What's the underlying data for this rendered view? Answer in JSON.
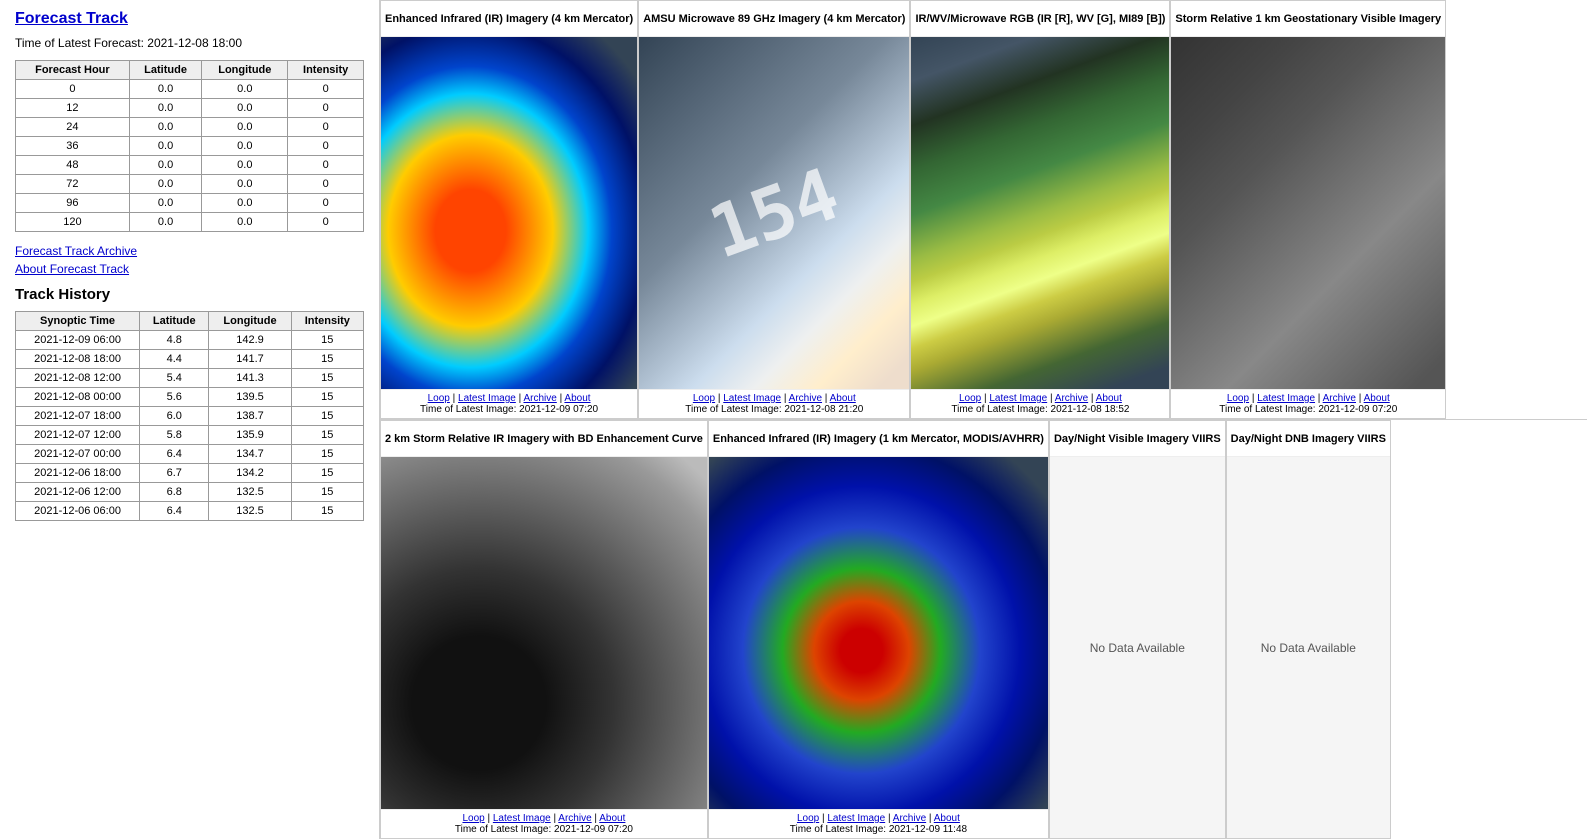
{
  "left": {
    "forecast_track_title": "Forecast Track",
    "latest_forecast_label": "Time of Latest Forecast: 2021-12-08 18:00",
    "forecast_table": {
      "headers": [
        "Forecast Hour",
        "Latitude",
        "Longitude",
        "Intensity"
      ],
      "rows": [
        [
          "0",
          "0.0",
          "0.0",
          "0"
        ],
        [
          "12",
          "0.0",
          "0.0",
          "0"
        ],
        [
          "24",
          "0.0",
          "0.0",
          "0"
        ],
        [
          "36",
          "0.0",
          "0.0",
          "0"
        ],
        [
          "48",
          "0.0",
          "0.0",
          "0"
        ],
        [
          "72",
          "0.0",
          "0.0",
          "0"
        ],
        [
          "96",
          "0.0",
          "0.0",
          "0"
        ],
        [
          "120",
          "0.0",
          "0.0",
          "0"
        ]
      ]
    },
    "forecast_track_archive_link": "Forecast Track Archive",
    "about_forecast_track_link": "About Forecast Track",
    "track_history_title": "Track History",
    "history_table": {
      "headers": [
        "Synoptic Time",
        "Latitude",
        "Longitude",
        "Intensity"
      ],
      "rows": [
        [
          "2021-12-09 06:00",
          "4.8",
          "142.9",
          "15"
        ],
        [
          "2021-12-08 18:00",
          "4.4",
          "141.7",
          "15"
        ],
        [
          "2021-12-08 12:00",
          "5.4",
          "141.3",
          "15"
        ],
        [
          "2021-12-08 00:00",
          "5.6",
          "139.5",
          "15"
        ],
        [
          "2021-12-07 18:00",
          "6.0",
          "138.7",
          "15"
        ],
        [
          "2021-12-07 12:00",
          "5.8",
          "135.9",
          "15"
        ],
        [
          "2021-12-07 00:00",
          "6.4",
          "134.7",
          "15"
        ],
        [
          "2021-12-06 18:00",
          "6.7",
          "134.2",
          "15"
        ],
        [
          "2021-12-06 12:00",
          "6.8",
          "132.5",
          "15"
        ],
        [
          "2021-12-06 06:00",
          "6.4",
          "132.5",
          "15"
        ]
      ]
    }
  },
  "right": {
    "row1": [
      {
        "title": "Enhanced Infrared (IR) Imagery (4 km Mercator)",
        "links": [
          "Loop",
          "Latest Image",
          "Archive",
          "About"
        ],
        "time": "Time of Latest Image: 2021-12-09 07:20",
        "img_class": "img-ir1",
        "no_data": false
      },
      {
        "title": "AMSU Microwave 89 GHz Imagery (4 km Mercator)",
        "links": [
          "Loop",
          "Latest Image",
          "Archive",
          "About"
        ],
        "time": "Time of Latest Image: 2021-12-08 21:20",
        "img_class": "img-mw",
        "no_data": false,
        "watermark": "154"
      },
      {
        "title": "IR/WV/Microwave RGB (IR [R], WV [G], MI89 [B])",
        "links": [
          "Loop",
          "Latest Image",
          "Archive",
          "About"
        ],
        "time": "Time of Latest Image: 2021-12-08 18:52",
        "img_class": "img-rgb",
        "no_data": false
      },
      {
        "title": "Storm Relative 1 km Geostationary Visible Imagery",
        "links": [
          "Loop",
          "Latest Image",
          "Archive",
          "About"
        ],
        "time": "Time of Latest Image: 2021-12-09 07:20",
        "img_class": "img-vis",
        "no_data": false
      }
    ],
    "row2": [
      {
        "title": "2 km Storm Relative IR Imagery with BD Enhancement Curve",
        "links": [
          "Loop",
          "Latest Image",
          "Archive",
          "About"
        ],
        "time": "Time of Latest Image: 2021-12-09 07:20",
        "img_class": "img-storm-ir",
        "no_data": false
      },
      {
        "title": "Enhanced Infrared (IR) Imagery (1 km Mercator, MODIS/AVHRR)",
        "links": [
          "Loop",
          "Latest Image",
          "Archive",
          "About"
        ],
        "time": "Time of Latest Image: 2021-12-09 11:48",
        "img_class": "img-ir1km",
        "no_data": false
      },
      {
        "title": "Day/Night Visible Imagery VIIRS",
        "no_data_text": "No Data Available",
        "no_data": true,
        "links": [],
        "time": ""
      },
      {
        "title": "Day/Night DNB Imagery VIIRS",
        "no_data_text": "No Data Available",
        "no_data": true,
        "links": [],
        "time": ""
      }
    ]
  }
}
